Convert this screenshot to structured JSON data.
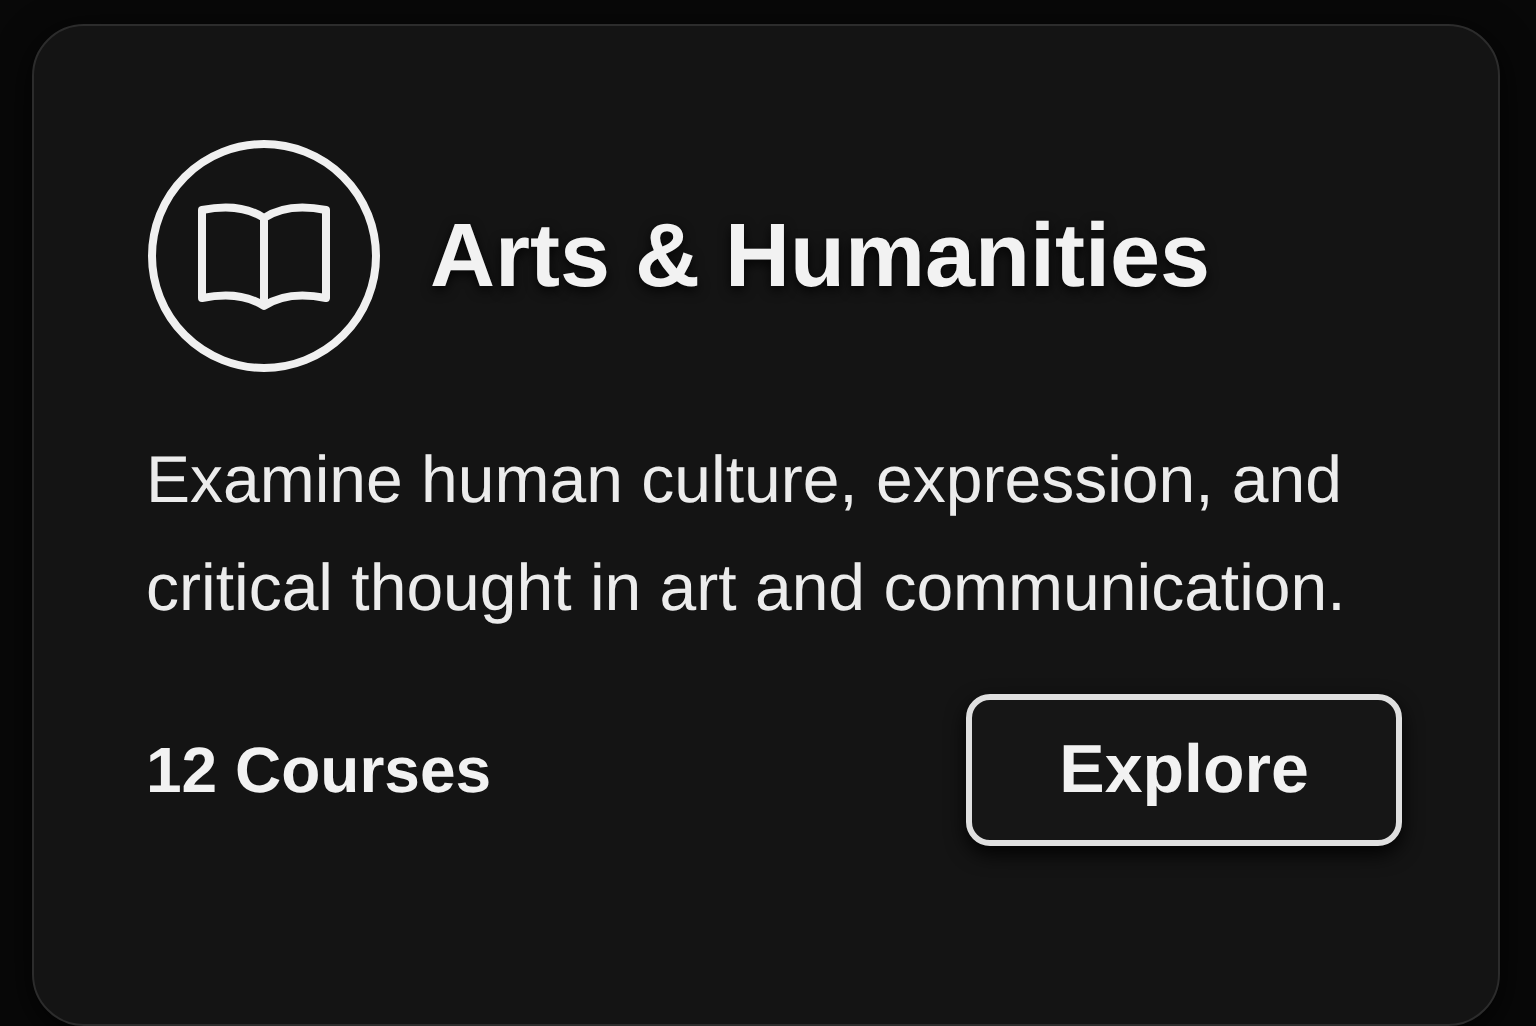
{
  "card": {
    "title": "Arts & Humanities",
    "description": "Examine human culture, expression, and critical thought in art and communication.",
    "course_count": "12 Courses",
    "button": "Explore"
  }
}
